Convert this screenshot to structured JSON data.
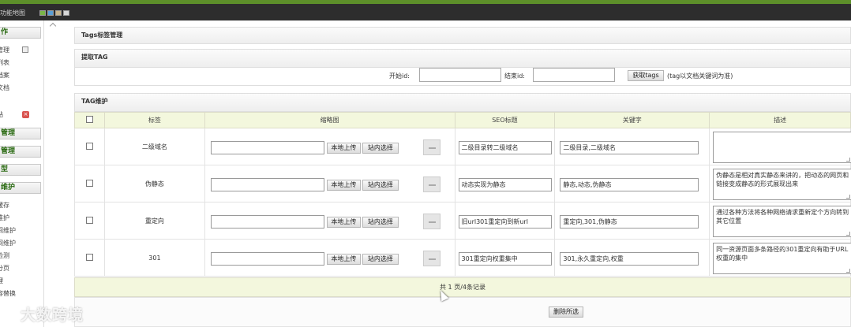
{
  "topbar": {
    "title": "功能地图"
  },
  "sidebar": {
    "heads": [
      "作",
      "管理",
      "管理",
      "型",
      "维护"
    ],
    "items_top": [
      "管理",
      "列表",
      "档案",
      "文档",
      "站"
    ],
    "items_bottom": [
      "缓存",
      "维护",
      "间维护",
      "间维护",
      "检测",
      "分页",
      "理",
      "容替换"
    ]
  },
  "page_title": "Tags标签管理",
  "extract": {
    "title": "提取TAG",
    "start_label": "开始id:",
    "end_label": "结束id:",
    "button": "获取tags",
    "note": "(tag以文档关键词为准)"
  },
  "maintain": {
    "title": "TAG维护"
  },
  "table": {
    "headers": [
      "",
      "标签",
      "缩略图",
      "SEO标题",
      "关键字",
      "描述"
    ],
    "upload_label": "本地上传",
    "select_label": "站内选择",
    "rows": [
      {
        "tag": "二级域名",
        "seo": "二级目录转二级域名",
        "kw": "二级目录,二级域名",
        "desc": ""
      },
      {
        "tag": "伪静态",
        "seo": "动态实现为静态",
        "kw": "静态,动态,伪静态",
        "desc": "伪静态是相对真实静态来讲的，把动态的网页和链接变成静态的形式展现出来"
      },
      {
        "tag": "重定向",
        "seo": "旧url301重定向到新url",
        "kw": "重定向,301,伪静态",
        "desc": "通过各种方法将各种网络请求重新定个方向转到其它位置"
      },
      {
        "tag": "301",
        "seo": "301重定向权重集中",
        "kw": "301,永久重定向,权重",
        "desc": "同一资源页面多条路径的301重定向有助于URL权重的集中"
      }
    ]
  },
  "pager": {
    "text": "共 1 页/4条记录"
  },
  "actions": {
    "delete": "删除所选"
  },
  "watermark": "大数跨境"
}
